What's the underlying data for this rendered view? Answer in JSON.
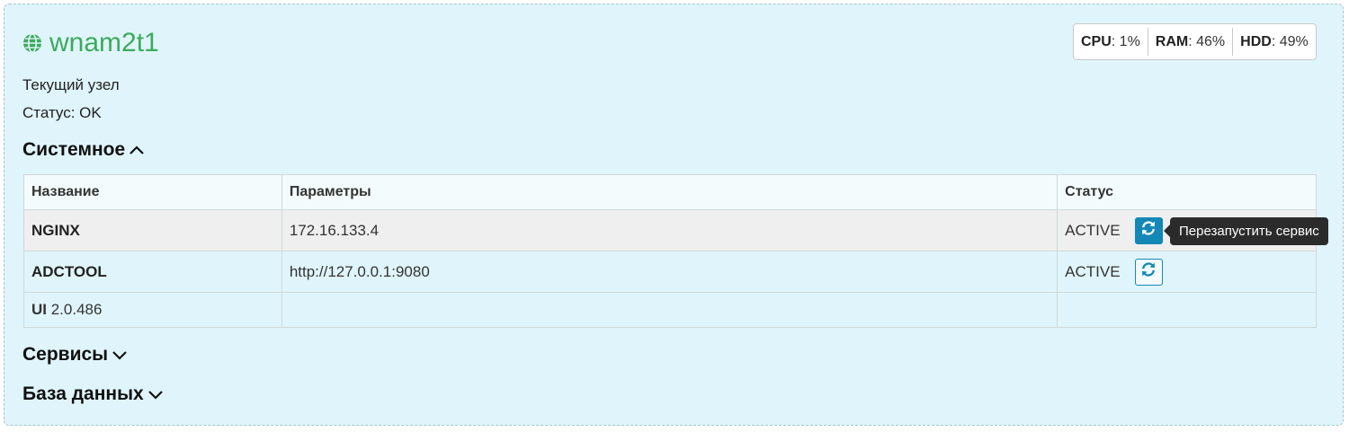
{
  "node": {
    "icon": "globe-icon",
    "name": "wnam2t1",
    "current_label": "Текущий узел",
    "status_text": "Статус: OK",
    "name_color": "#3daa5c"
  },
  "stats": {
    "cpu_label": "CPU",
    "cpu_value": ": 1%",
    "ram_label": "RAM",
    "ram_value": ": 46%",
    "hdd_label": "HDD",
    "hdd_value": ": 49%"
  },
  "sections": {
    "system": {
      "label": "Системное",
      "icon": "chevron-up-icon"
    },
    "services": {
      "label": "Сервисы",
      "icon": "chevron-down-icon"
    },
    "database": {
      "label": "База данных",
      "icon": "chevron-down-icon"
    }
  },
  "table": {
    "headers": [
      "Название",
      "Параметры",
      "Статус"
    ],
    "rows": [
      {
        "name": "NGINX",
        "params": "172.16.133.4",
        "status": "ACTIVE",
        "action_icon": "refresh-icon"
      },
      {
        "name": "ADCTOOL",
        "params": "http://127.0.0.1:9080",
        "status": "ACTIVE",
        "action_icon": "refresh-icon"
      },
      {
        "name": "UI",
        "version": " 2.0.486",
        "params": "",
        "status": ""
      }
    ]
  },
  "tooltip": {
    "text": "Перезапустить сервис"
  },
  "colors": {
    "accent": "#1387b5",
    "card_bg": "#e0f5fb"
  }
}
